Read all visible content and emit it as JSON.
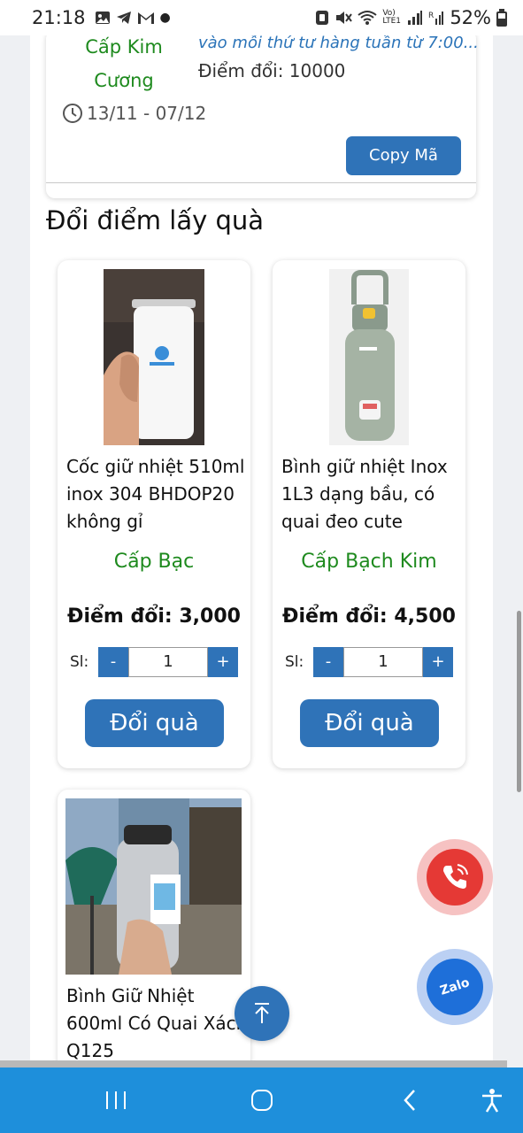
{
  "status_bar": {
    "time": "21:18",
    "battery_text": "52%",
    "left_icons": [
      "gallery-icon",
      "telegram-icon",
      "gmail-icon",
      "dot-icon"
    ],
    "right_icons": [
      "nfc-icon",
      "mute-icon",
      "wifi-icon",
      "volte-icon",
      "signal-icon",
      "signal-r-icon",
      "battery-icon"
    ],
    "volte_label": "Vo) LTE1"
  },
  "voucher": {
    "level": "Cấp Kim Cương",
    "description": "vào mỗi thứ tư hàng tuần từ 7:00...",
    "points_label": "Điểm đổi: 10000",
    "date_range": "13/11 - 07/12",
    "copy_label": "Copy Mã"
  },
  "section": {
    "title": "Đổi điểm lấy quà"
  },
  "products": [
    {
      "name": "Cốc giữ nhiệt 510ml inox 304 BHDOP20 không gỉ",
      "level": "Cấp Bạc",
      "points_label": "Điểm đổi: 3,000",
      "qty_label": "Sl:",
      "qty_value": "1",
      "minus": "-",
      "plus": "+",
      "redeem_label": "Đổi quà",
      "image": "white-tumbler-image"
    },
    {
      "name": "Bình giữ nhiệt Inox 1L3 dạng bầu, có quai đeo cute",
      "level": "Cấp Bạch Kim",
      "points_label": "Điểm đổi: 4,500",
      "qty_label": "Sl:",
      "qty_value": "1",
      "minus": "-",
      "plus": "+",
      "redeem_label": "Đổi quà",
      "image": "green-bottle-image"
    },
    {
      "name": "Bình Giữ Nhiệt 600ml Có Quai Xách Q125",
      "image": "steel-flask-image"
    }
  ],
  "floating": {
    "scroll_top_icon": "arrow-up-icon",
    "call_icon": "phone-icon",
    "zalo_label": "Zalo"
  },
  "nav_bar": {
    "items": [
      "recent-apps-icon",
      "home-icon",
      "back-icon",
      "accessibility-icon"
    ]
  },
  "colors": {
    "accent_blue": "#2f73b8",
    "level_green": "#1e8a1e",
    "nav_blue": "#1e8fdb",
    "call_red": "#e53935"
  }
}
